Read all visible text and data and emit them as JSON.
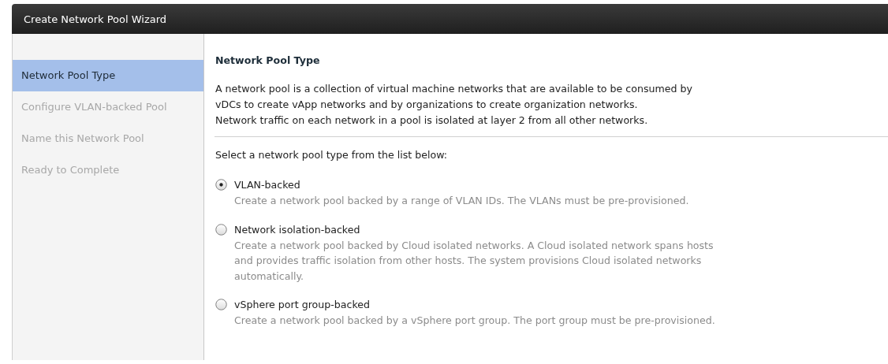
{
  "window": {
    "title": "Create Network Pool Wizard"
  },
  "steps": [
    {
      "label": "Network Pool Type",
      "selected": true,
      "disabled": false
    },
    {
      "label": "Configure VLAN-backed Pool",
      "selected": false,
      "disabled": true
    },
    {
      "label": "Name this Network Pool",
      "selected": false,
      "disabled": true
    },
    {
      "label": "Ready to Complete",
      "selected": false,
      "disabled": true
    }
  ],
  "page": {
    "heading": "Network Pool Type",
    "intro_lines": [
      "A network pool is a collection of virtual machine networks that are available to be consumed by",
      "vDCs to create vApp networks and by organizations to create organization networks.",
      "Network traffic on each network in a pool is isolated at layer 2 from all other networks."
    ],
    "prompt": "Select a network pool type from the list below:",
    "options": [
      {
        "label": "VLAN-backed",
        "selected": true,
        "description_lines": [
          "Create a network pool backed by a range of VLAN IDs. The VLANs must be pre-provisioned."
        ]
      },
      {
        "label": "Network isolation-backed",
        "selected": false,
        "description_lines": [
          "Create a network pool backed by Cloud isolated networks. A Cloud isolated network spans hosts",
          "and provides traffic isolation from other hosts. The system provisions Cloud isolated networks",
          "automatically."
        ]
      },
      {
        "label": "vSphere port group-backed",
        "selected": false,
        "description_lines": [
          "Create a network pool backed by a vSphere port group. The port group must be pre-provisioned."
        ]
      }
    ]
  }
}
